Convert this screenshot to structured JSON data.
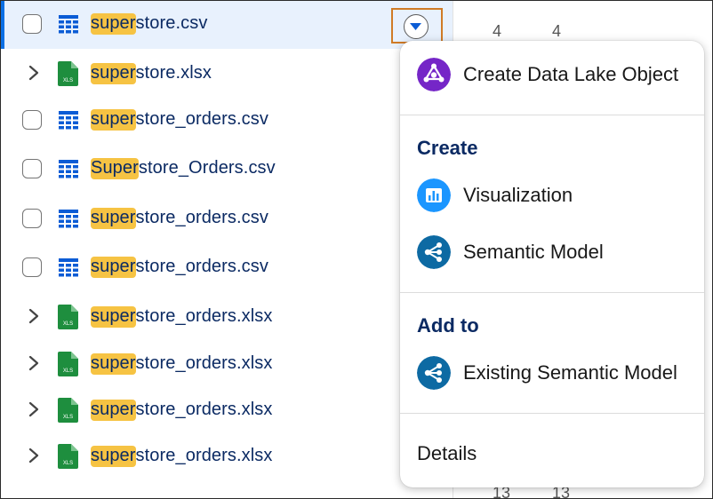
{
  "files": [
    {
      "highlight": "super",
      "rest": "store.csv",
      "type": "csv",
      "selected": true
    },
    {
      "highlight": "super",
      "rest": "store.xlsx",
      "type": "xlsx"
    },
    {
      "highlight": "super",
      "rest": "store_orders.csv",
      "type": "csv"
    },
    {
      "highlight": "Super",
      "rest": "store_Orders.csv",
      "type": "csv"
    },
    {
      "highlight": "super",
      "rest": "store_orders.csv",
      "type": "csv"
    },
    {
      "highlight": "super",
      "rest": "store_orders.csv",
      "type": "csv"
    },
    {
      "highlight": "super",
      "rest": "store_orders.xlsx",
      "type": "xlsx"
    },
    {
      "highlight": "super",
      "rest": "store_orders.xlsx",
      "type": "xlsx"
    },
    {
      "highlight": "super",
      "rest": "store_orders.xlsx",
      "type": "xlsx"
    },
    {
      "highlight": "super",
      "rest": "store_orders.xlsx",
      "type": "xlsx"
    }
  ],
  "xls_icon_text": "XLS",
  "background_grid": {
    "top_values": [
      "4",
      "4"
    ],
    "bottom_values": [
      "13",
      "13"
    ]
  },
  "menu": {
    "create_dlo_label": "Create Data Lake Object",
    "create_heading": "Create",
    "visualization_label": "Visualization",
    "semantic_model_label": "Semantic Model",
    "add_to_heading": "Add to",
    "existing_semantic_model_label": "Existing Semantic Model",
    "details_label": "Details"
  },
  "colors": {
    "highlight": "#f6c343",
    "selected_row": "#e8f1fd",
    "focus_outline": "#d07b26",
    "csv_icon": "#0b5cd5",
    "xls_icon": "#1e8e3e",
    "dlo_icon": "#7526c7",
    "visualization_icon": "#1b96ff",
    "semantic_icon": "#0d6aa3"
  }
}
